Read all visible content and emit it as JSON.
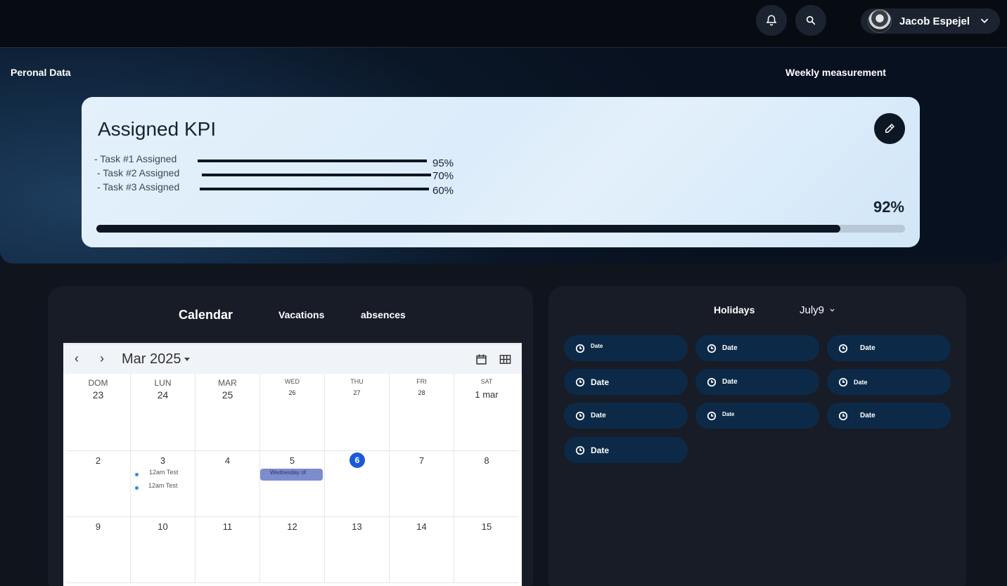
{
  "header": {
    "user_name": "Jacob Espejel",
    "icons": [
      "bell-icon",
      "search-icon",
      "chevron-down-icon"
    ]
  },
  "hero": {
    "left_label": "Peronal Data",
    "right_label": "Weekly measurement"
  },
  "kpi": {
    "title": "Assigned KPI",
    "tasks": [
      {
        "label": "- Task #1 Assigned",
        "percent": "95%",
        "progress": 0.95
      },
      {
        "label": "- Task #2 Assigned",
        "percent": "70%",
        "progress": 0.7
      },
      {
        "label": "- Task #3 Assigned",
        "percent": "60%",
        "progress": 0.6
      }
    ],
    "overall_percent": "92%",
    "overall_progress": 0.92
  },
  "calendar_panel": {
    "tabs": [
      "Calendar",
      "Vacations",
      "absences"
    ],
    "month_label": "Mar 2025",
    "day_names": [
      "DOM",
      "LUN",
      "MAR",
      "WED",
      "THU",
      "FRI",
      "SAT"
    ],
    "weeks": [
      [
        "23",
        "24",
        "25",
        "26",
        "27",
        "28",
        "1 mar"
      ],
      [
        "2",
        "3",
        "4",
        "5",
        "6",
        "7",
        "8"
      ],
      [
        "9",
        "10",
        "11",
        "12",
        "13",
        "14",
        "15"
      ]
    ],
    "today": "6",
    "events": {
      "lun_3": [
        "12am Test",
        "12am Test"
      ],
      "wed_5": "Wednesday of"
    }
  },
  "holidays_panel": {
    "title": "Holidays",
    "month_select": "July9",
    "dates": [
      "Date",
      "Date",
      "Date",
      "Date",
      "Date",
      "Date",
      "Date",
      "Date",
      "Date",
      "Date"
    ]
  },
  "colors": {
    "accent_blue": "#1a5ad6",
    "pill_bg": "#0c2a48",
    "panel_bg": "#171c27"
  }
}
